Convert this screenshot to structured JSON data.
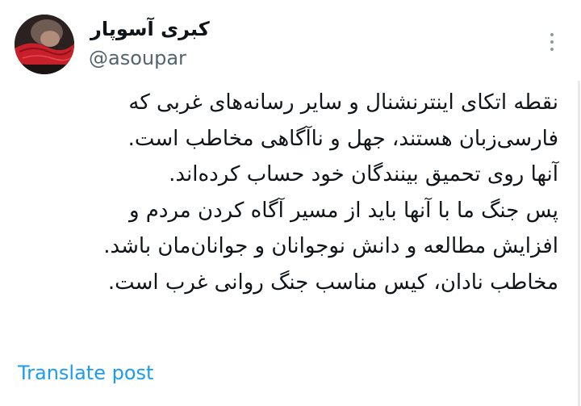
{
  "author": {
    "display_name": "کبری آسوپار",
    "handle": "@asoupar",
    "avatar_icon": "profile-photo-red-scarf"
  },
  "post": {
    "lines": [
      "نقطه اتکای اینترنشنال و سایر رسانه‌های غربی که",
      "فارسی‌زبان هستند، جهل و ناآگاهی مخاطب است.",
      "آنها روی تحمیق بینندگان خود حساب کرده‌اند.",
      "پس جنگ ما با آنها باید از مسیر آگاه کردن مردم و",
      "افزایش مطالعه و دانش نوجوانان و جوانان‌مان باشد.",
      "مخاطب نادان، کیس مناسب جنگ روانی غرب است."
    ]
  },
  "actions": {
    "translate_label": "Translate post",
    "more_icon": "more-vertical-icon"
  },
  "colors": {
    "text": "#0f1419",
    "secondary": "#536471",
    "link": "#1d9bf0",
    "avatar_accent": "#c8202a"
  }
}
